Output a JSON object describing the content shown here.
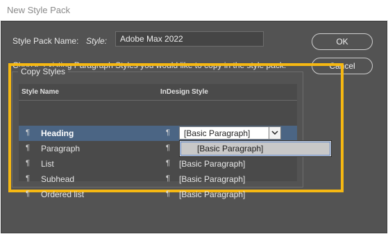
{
  "window": {
    "title": "New Style Pack"
  },
  "form": {
    "name_label": "Style Pack Name:",
    "style_label": "Style:",
    "name_value": "Adobe Max 2022",
    "instructions": "Choose existing Paragraph Styles you would like to copy in the style pack:"
  },
  "buttons": {
    "ok": "OK",
    "cancel": "Cancel"
  },
  "copy_styles": {
    "legend": "Copy Styles",
    "columns": [
      "Style Name",
      "InDesign Style"
    ],
    "glyph": "¶",
    "rows": [
      {
        "name": "Heading",
        "style": "[Basic Paragraph]",
        "selected": true
      },
      {
        "name": "Paragraph",
        "style": "[Basic Paragraph]"
      },
      {
        "name": "List",
        "style": "[Basic Paragraph]"
      },
      {
        "name": "Subhead",
        "style": "[Basic Paragraph]"
      },
      {
        "name": "Ordered list",
        "style": "[Basic Paragraph]"
      }
    ]
  },
  "dropdown": {
    "options": [
      "[Basic Paragraph]"
    ]
  },
  "colors": {
    "dialog_bg": "#535353",
    "highlight": "#f6b812",
    "selected_row": "#4b6584"
  },
  "icons": {
    "dropdown_arrow": "chevron-down-icon",
    "paragraph": "pilcrow-icon"
  }
}
